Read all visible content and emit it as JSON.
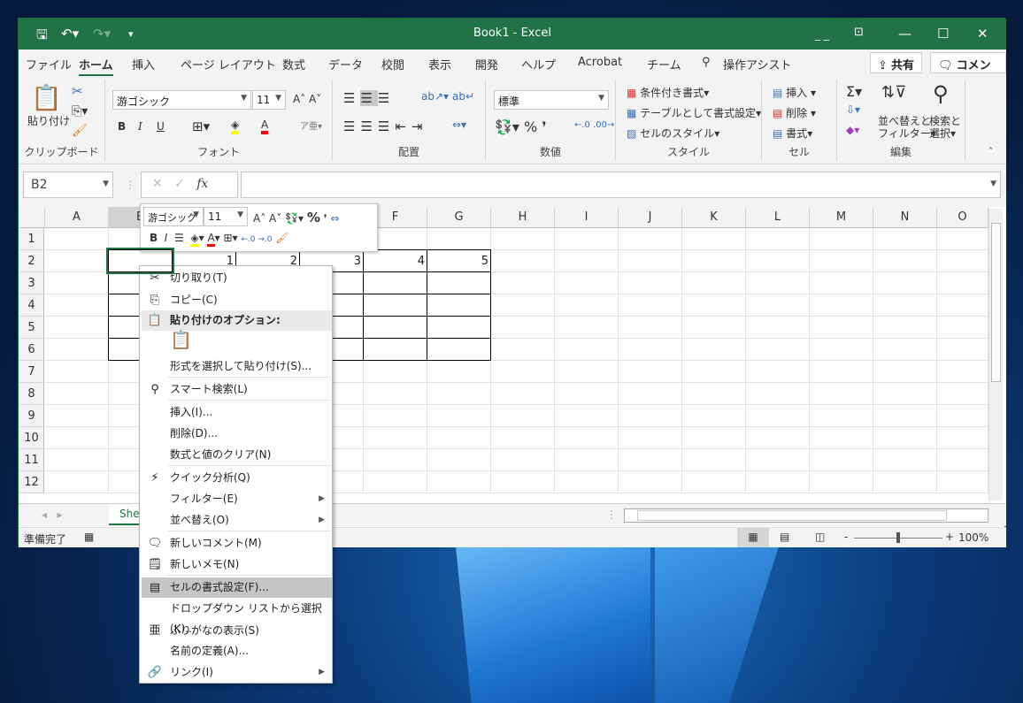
{
  "window": {
    "title": "Book1  -  Excel",
    "user_initials": "_ _"
  },
  "tabs": [
    "ファイル",
    "ホーム",
    "挿入",
    "ページ レイアウト",
    "数式",
    "データ",
    "校閲",
    "表示",
    "開発",
    "ヘルプ",
    "Acrobat",
    "チーム"
  ],
  "active_tab": "ホーム",
  "tell_me": "操作アシスト",
  "share": "共有",
  "comment": "コメント",
  "ribbon": {
    "clipboard": {
      "paste": "貼り付け",
      "label": "クリップボード"
    },
    "font": {
      "name": "游ゴシック",
      "size": "11",
      "label": "フォント",
      "bold": "B",
      "italic": "I",
      "underline": "U"
    },
    "alignment": {
      "label": "配置"
    },
    "number": {
      "format": "標準",
      "label": "数値"
    },
    "styles": {
      "conditional": "条件付き書式",
      "table": "テーブルとして書式設定",
      "cell_styles": "セルのスタイル",
      "label": "スタイル"
    },
    "cells": {
      "insert": "挿入",
      "delete": "削除",
      "format": "書式",
      "label": "セル"
    },
    "editing": {
      "sort1": "並べ替えと",
      "sort2": "フィルター",
      "find1": "検索と",
      "find2": "選択",
      "label": "編集"
    }
  },
  "name_box": "B2",
  "formula_fx": "fx",
  "columns": [
    "A",
    "B",
    "C",
    "D",
    "E",
    "F",
    "G",
    "H",
    "I",
    "J",
    "K",
    "L",
    "M",
    "N",
    "O"
  ],
  "rows": [
    "1",
    "2",
    "3",
    "4",
    "5",
    "6",
    "7",
    "8",
    "9",
    "10",
    "11",
    "12"
  ],
  "cells": {
    "C2": "1",
    "D2": "2",
    "E2": "3",
    "F2": "4",
    "G2": "5"
  },
  "sheet_tab": "Sheet1",
  "status": {
    "ready": "準備完了",
    "zoom": "100%"
  },
  "mini_toolbar": {
    "font": "游ゴシック",
    "size": "11"
  },
  "context_menu": [
    {
      "label": "切り取り(T)",
      "icon": "scissors-icon"
    },
    {
      "label": "コピー(C)",
      "icon": "copy-icon"
    },
    {
      "label": "貼り付けのオプション:",
      "icon": "paste-icon",
      "header": true
    },
    {
      "label": "",
      "icon": "paste-option-icon"
    },
    {
      "label": "形式を選択して貼り付け(S)..."
    },
    {
      "label": "スマート検索(L)",
      "icon": "smart-lookup-icon"
    },
    {
      "label": "挿入(I)..."
    },
    {
      "label": "削除(D)..."
    },
    {
      "label": "数式と値のクリア(N)"
    },
    {
      "label": "クイック分析(Q)",
      "icon": "quick-analysis-icon"
    },
    {
      "label": "フィルター(E)",
      "submenu": true
    },
    {
      "label": "並べ替え(O)",
      "submenu": true
    },
    {
      "label": "新しいコメント(M)",
      "icon": "new-comment-icon"
    },
    {
      "label": "新しいメモ(N)",
      "icon": "new-note-icon"
    },
    {
      "label": "セルの書式設定(F)...",
      "icon": "format-cells-icon",
      "highlighted": true
    },
    {
      "label": "ドロップダウン リストから選択(K)..."
    },
    {
      "label": "ふりがなの表示(S)",
      "icon": "furigana-icon"
    },
    {
      "label": "名前の定義(A)..."
    },
    {
      "label": "リンク(I)",
      "icon": "link-icon",
      "submenu": true
    }
  ],
  "colors": {
    "excel_green": "#217346",
    "highlight": "#c6c6c6",
    "fill_yellow": "#ffff00",
    "font_red": "#ff0000"
  }
}
